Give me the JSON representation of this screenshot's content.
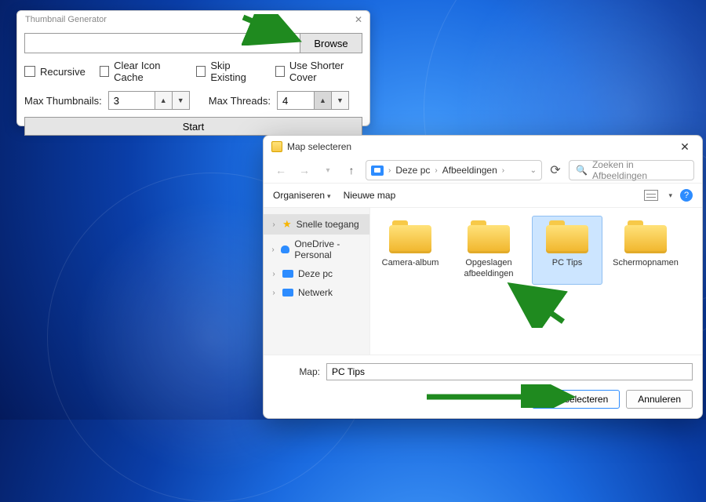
{
  "tg": {
    "title": "Thumbnail Generator",
    "browse": "Browse",
    "checkboxes": {
      "recursive": "Recursive",
      "clear_cache": "Clear Icon Cache",
      "skip_existing": "Skip Existing",
      "shorter_cover": "Use Shorter Cover"
    },
    "max_thumbs_label": "Max Thumbnails:",
    "max_thumbs_value": "3",
    "max_threads_label": "Max Threads:",
    "max_threads_value": "4",
    "start": "Start",
    "path_value": ""
  },
  "fp": {
    "title": "Map selecteren",
    "breadcrumb": {
      "root": "Deze pc",
      "folder": "Afbeeldingen"
    },
    "search_placeholder": "Zoeken in Afbeeldingen",
    "toolbar": {
      "organize": "Organiseren",
      "newfolder": "Nieuwe map",
      "help": "?"
    },
    "sidebar": [
      {
        "label": "Snelle toegang",
        "icon": "star",
        "active": true,
        "expand": "›"
      },
      {
        "label": "OneDrive - Personal",
        "icon": "cloud",
        "active": false,
        "expand": "›"
      },
      {
        "label": "Deze pc",
        "icon": "pc",
        "active": false,
        "expand": "›"
      },
      {
        "label": "Netwerk",
        "icon": "net",
        "active": false,
        "expand": "›"
      }
    ],
    "folders": [
      {
        "name": "Camera-album",
        "selected": false
      },
      {
        "name": "Opgeslagen afbeeldingen",
        "selected": false
      },
      {
        "name": "PC Tips",
        "selected": true
      },
      {
        "name": "Schermopnamen",
        "selected": false
      }
    ],
    "map_label": "Map:",
    "map_value": "PC Tips",
    "select_btn": "Map selecteren",
    "cancel_btn": "Annuleren"
  }
}
